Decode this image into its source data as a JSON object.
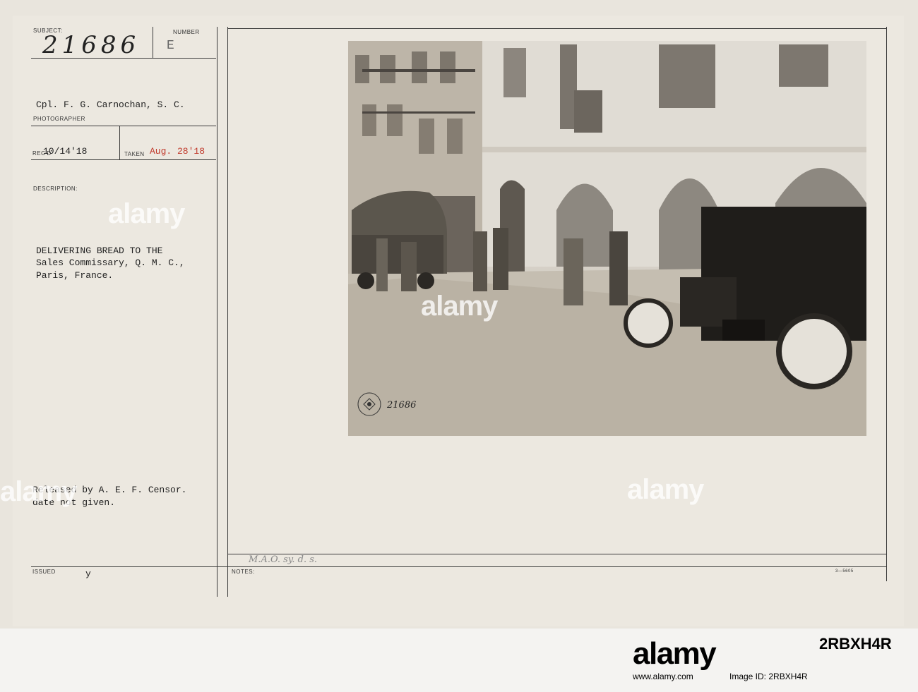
{
  "header": {
    "subject_label": "SUBJECT:",
    "subject_number": "21686",
    "number_label": "NUMBER",
    "number_value": "E",
    "photographer_name": "Cpl. F. G. Carnochan, S. C.",
    "photographer_label": "PHOTOGRAPHER",
    "recd_label": "REC'D",
    "recd_value": "10/14'18",
    "taken_label": "TAKEN",
    "taken_value": "Aug. 28'18",
    "description_label": "DESCRIPTION:"
  },
  "description": {
    "line1": "DELIVERING BREAD TO THE",
    "line2": "Sales Commissary, Q. M. C.,",
    "line3": "Paris, France."
  },
  "release": {
    "line1": "Released by A. E. F. Censor.",
    "line2": "date not given."
  },
  "footer": {
    "issued_label": "ISSUED",
    "issued_value": "y",
    "notes_label": "NOTES:",
    "pencil_note": "M.A.O. sy. d. s.",
    "form_number": "3—5605"
  },
  "photo": {
    "stamp_text": "SIGNAL CORPS U.S.A.",
    "stamp_number": "21686"
  },
  "watermarks": [
    "alamy",
    "alamy",
    "alamy",
    "alamy"
  ],
  "branding": {
    "logo": "alamy",
    "image_id": "Image ID: 2RBXH4R",
    "url": "www.alamy.com",
    "code": "2RBXH4R"
  }
}
